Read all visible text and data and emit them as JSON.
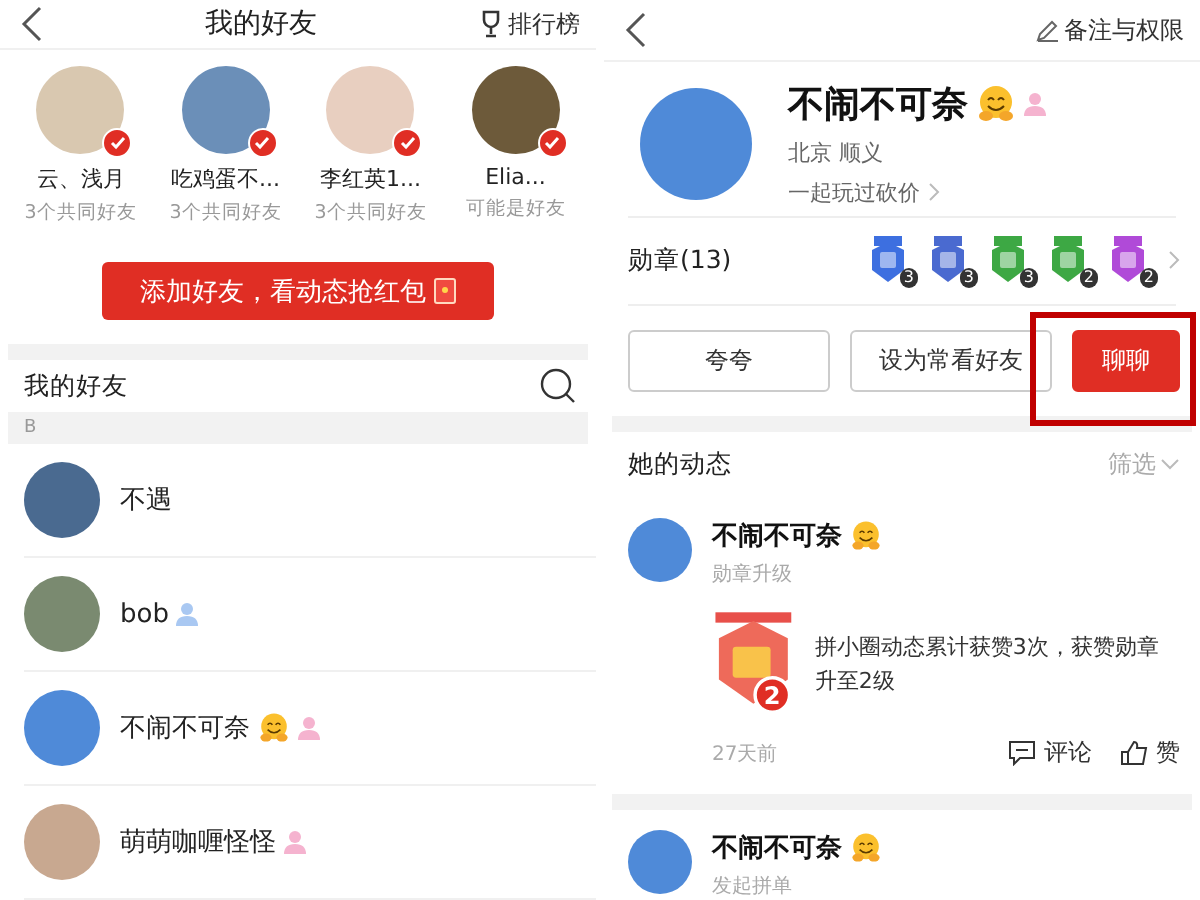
{
  "left": {
    "title": "我的好友",
    "ranking": "排行榜",
    "suggestions": [
      {
        "name": "云、浅月",
        "sub": "3个共同好友",
        "added": true
      },
      {
        "name": "吃鸡蛋不...",
        "sub": "3个共同好友",
        "added": true
      },
      {
        "name": "李红英1...",
        "sub": "3个共同好友",
        "added": true
      },
      {
        "name": "Elia...",
        "sub": "可能是好友",
        "added": true
      }
    ],
    "add_button": "添加好友，看动态抢红包",
    "list_title": "我的好友",
    "section": "B",
    "friends": [
      {
        "name": "不遇",
        "emoji": false
      },
      {
        "name": "bob",
        "emoji": false,
        "color": "#a9c8f2"
      },
      {
        "name": "不闹不可奈",
        "emoji": true,
        "color": "#f5b3cf"
      },
      {
        "name": "萌萌咖喱怪怪",
        "emoji": false,
        "color": "#f5b3cf"
      }
    ]
  },
  "right": {
    "edit": "备注与权限",
    "name": "不闹不可奈",
    "gender": {
      "color": "#f5b3cf"
    },
    "location": "北京 顺义",
    "played": "一起玩过砍价",
    "medals_label": "勋章(13)",
    "medals": [
      {
        "color": "#3d6fe0",
        "count": "3"
      },
      {
        "color": "#4a6ad0",
        "count": "3"
      },
      {
        "color": "#3da844",
        "count": "3"
      },
      {
        "color": "#3da844",
        "count": "2"
      },
      {
        "color": "#b04ad8",
        "count": "2"
      }
    ],
    "buttons": [
      {
        "label": "夸夸",
        "kind": "plain"
      },
      {
        "label": "设为常看好友",
        "kind": "plain"
      },
      {
        "label": "聊聊",
        "kind": "primary"
      }
    ],
    "highlighted": true,
    "feed_title": "她的动态",
    "filter": "筛选",
    "posts": [
      {
        "name": "不闹不可奈",
        "type": "勋章升级",
        "text": "拼小圈动态累计获赞3次，获赞勋章升至2级",
        "medal": "2",
        "time": "27天前",
        "comment": "评论",
        "like": "赞"
      },
      {
        "name": "不闹不可奈",
        "type": "发起拼单"
      }
    ]
  }
}
